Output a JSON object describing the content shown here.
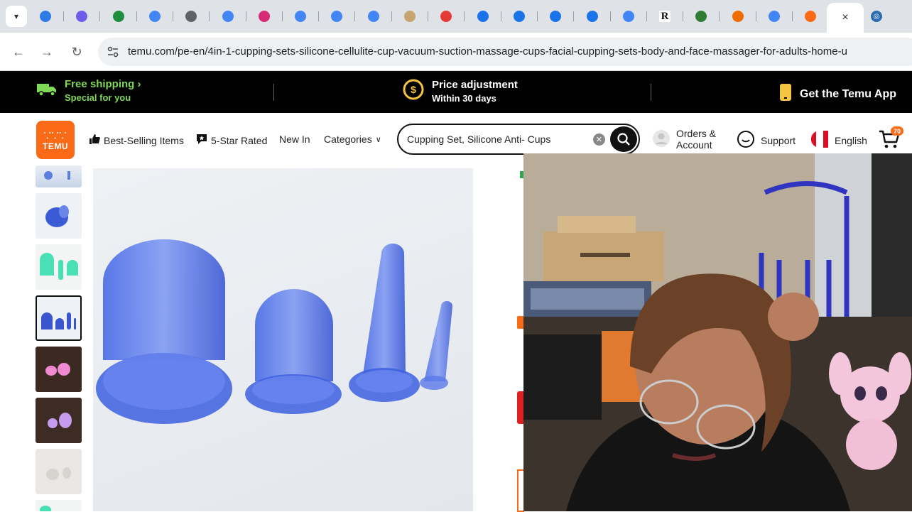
{
  "browser": {
    "tab_menu_icon": "chevron-down-icon",
    "tabs": [
      {
        "icon": "edge-icon",
        "color": "#2f7be6"
      },
      {
        "icon": "printer-icon",
        "color": "#6c5ce7"
      },
      {
        "icon": "sheets-icon",
        "color": "#1e8e3e"
      },
      {
        "icon": "google-icon",
        "color": "#4285f4"
      },
      {
        "icon": "globe-icon",
        "color": "#5f6368"
      },
      {
        "icon": "google-icon",
        "color": "#4285f4"
      },
      {
        "icon": "instagram-icon",
        "color": "#d62976"
      },
      {
        "icon": "google-icon",
        "color": "#4285f4"
      },
      {
        "icon": "google-icon",
        "color": "#4285f4"
      },
      {
        "icon": "google-icon",
        "color": "#4285f4"
      },
      {
        "icon": "cookie-icon",
        "color": "#c8a46e"
      },
      {
        "icon": "cross-icon",
        "color": "#e53935"
      },
      {
        "icon": "star-icon",
        "color": "#1a73e8"
      },
      {
        "icon": "star-icon",
        "color": "#1a73e8"
      },
      {
        "icon": "star-icon",
        "color": "#1a73e8"
      },
      {
        "icon": "star-icon",
        "color": "#1a73e8"
      },
      {
        "icon": "google-icon",
        "color": "#4285f4"
      },
      {
        "icon": "r-icon",
        "color": "#111111",
        "glyph": "R"
      },
      {
        "icon": "plus-circle-icon",
        "color": "#2e7d32"
      },
      {
        "icon": "house-icon",
        "color": "#ef6c00"
      },
      {
        "icon": "google-icon",
        "color": "#4285f4"
      },
      {
        "icon": "temu-icon",
        "color": "#fb6a16"
      }
    ],
    "active_tab_close": "×",
    "url": "temu.com/pe-en/4in-1-cupping-sets-silicone-cellulite-cup-vacuum-suction-massage-cups-facial-cupping-sets-body-and-face-massager-for-adults-home-u"
  },
  "promo": {
    "shipping_title": "Free shipping",
    "shipping_chevron": "›",
    "shipping_sub": "Special for you",
    "price_title": "Price adjustment",
    "price_sub": "Within 30 days",
    "app_title": "Get the Temu App",
    "accent": "#7ed957"
  },
  "header": {
    "logo_top": "⸪⸪⸪",
    "logo_text": "TEMU",
    "nav": {
      "best_selling": "Best-Selling Items",
      "five_star": "5-Star Rated",
      "new_in": "New In",
      "categories": "Categories"
    },
    "search_value": "Cupping Set, Silicone Anti- Cups",
    "orders_line1": "Orders &",
    "orders_line2": "Account",
    "support": "Support",
    "language": "English",
    "cart_count": "70"
  },
  "gallery": {
    "thumbs": [
      {
        "desc": "blue-cups",
        "selected": false
      },
      {
        "desc": "blue-cup-hand",
        "selected": false
      },
      {
        "desc": "mint-cups",
        "selected": false
      },
      {
        "desc": "blue-cups-set",
        "selected": true
      },
      {
        "desc": "pink-cups-dark",
        "selected": false
      },
      {
        "desc": "purple-cups-dark",
        "selected": false
      },
      {
        "desc": "clear-cups",
        "selected": false
      }
    ]
  }
}
